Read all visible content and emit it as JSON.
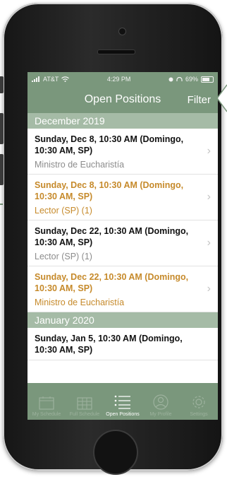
{
  "status_bar": {
    "carrier": "AT&T",
    "time": "4:29 PM",
    "battery": "69%"
  },
  "nav": {
    "title": "Open Positions",
    "filter_label": "Filter"
  },
  "sections": [
    {
      "header": "December 2019",
      "items": [
        {
          "date_line": "Sunday, Dec 8, 10:30 AM (Domingo, 10:30 AM, SP)",
          "role": "Ministro de Eucharistía",
          "highlight": false
        },
        {
          "date_line": "Sunday, Dec 8, 10:30 AM (Domingo, 10:30 AM, SP)",
          "role": "Lector (SP) (1)",
          "highlight": true
        },
        {
          "date_line": "Sunday, Dec 22, 10:30 AM (Domingo, 10:30 AM, SP)",
          "role": "Lector (SP) (1)",
          "highlight": false
        },
        {
          "date_line": "Sunday, Dec 22, 10:30 AM (Domingo, 10:30 AM, SP)",
          "role": "Ministro de Eucharistía",
          "highlight": true
        }
      ]
    },
    {
      "header": "January 2020",
      "items": [
        {
          "date_line": "Sunday, Jan 5, 10:30 AM (Domingo, 10:30 AM, SP)",
          "role": "",
          "highlight": false
        }
      ]
    }
  ],
  "tabs": [
    {
      "label": "My Schedule",
      "icon": "calendar-icon",
      "active": false
    },
    {
      "label": "Full Schedule",
      "icon": "calendar-grid-icon",
      "active": false
    },
    {
      "label": "Open Positions",
      "icon": "list-icon",
      "active": true
    },
    {
      "label": "My Profile",
      "icon": "profile-icon",
      "active": false
    },
    {
      "label": "Settings",
      "icon": "gear-icon",
      "active": false
    }
  ],
  "colors": {
    "brand": "#7a977c",
    "section": "#a5bba6",
    "highlight": "#c68a2b"
  }
}
